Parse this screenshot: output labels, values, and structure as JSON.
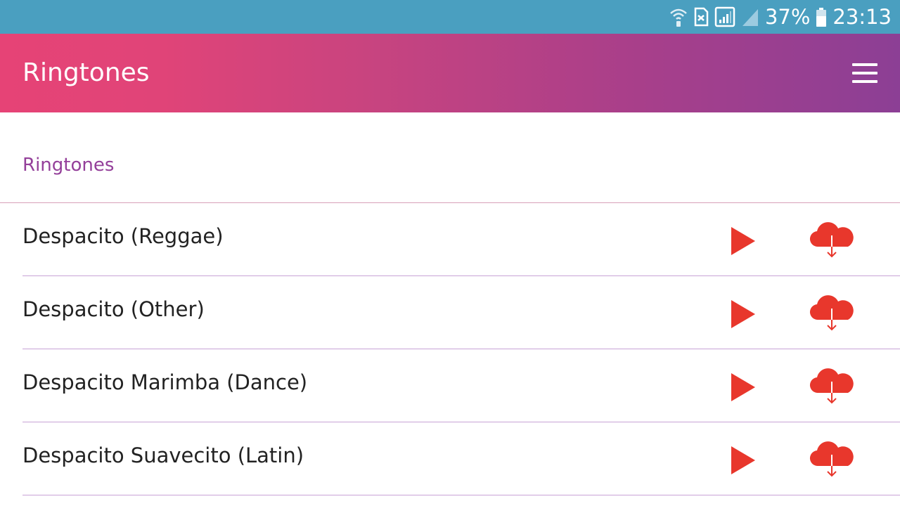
{
  "status_bar": {
    "battery": "37%",
    "time": "23:13",
    "background": "#4a9fc0",
    "icons": [
      "wifi-calling-icon",
      "sim-card-icon",
      "signal-icon",
      "signal-empty-icon",
      "battery-icon"
    ]
  },
  "app_bar": {
    "title": "Ringtones",
    "menu_icon": "hamburger-menu-icon",
    "gradient_start": "#e64376",
    "gradient_end": "#8c3f95"
  },
  "section": {
    "title": "Ringtones",
    "color": "#94409a"
  },
  "ringtones": [
    {
      "title": "Despacito (Reggae)"
    },
    {
      "title": "Despacito (Other)"
    },
    {
      "title": "Despacito Marimba (Dance)"
    },
    {
      "title": "Despacito Suavecito (Latin)"
    }
  ],
  "icons": {
    "play": "play-icon",
    "download": "cloud-download-icon",
    "accent": "#e8372c"
  }
}
